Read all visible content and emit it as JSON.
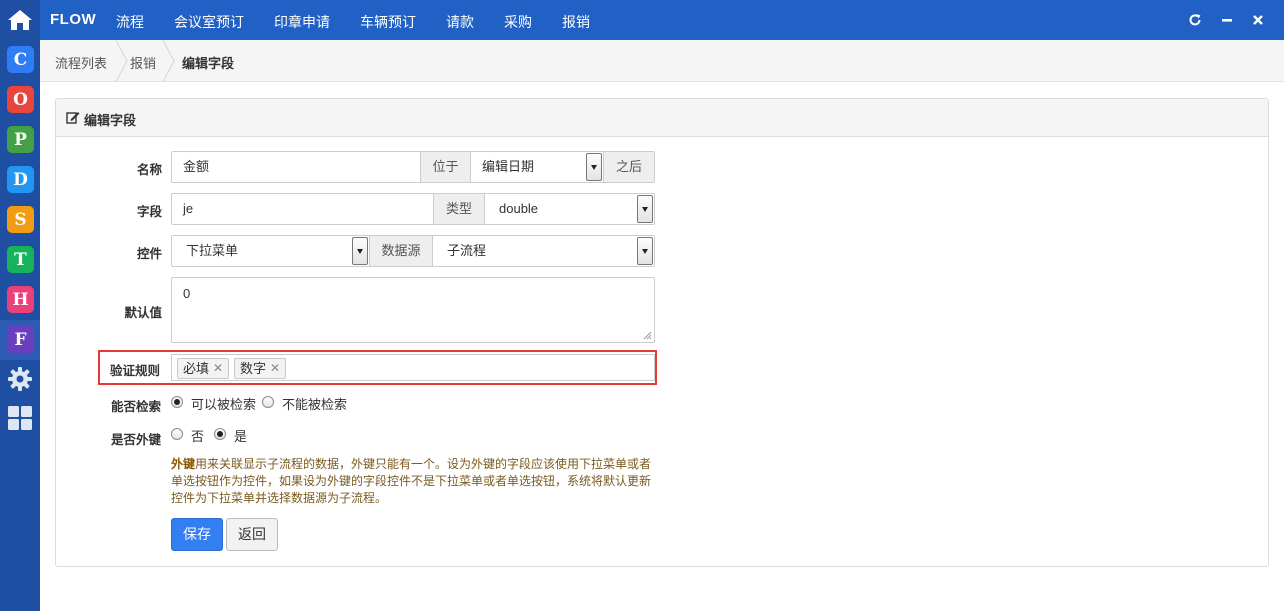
{
  "sidebar": {
    "apps": [
      {
        "letter": "C",
        "color": "#2f7df6"
      },
      {
        "letter": "O",
        "color": "#e8453c"
      },
      {
        "letter": "P",
        "color": "#43a047"
      },
      {
        "letter": "D",
        "color": "#2196f3"
      },
      {
        "letter": "S",
        "color": "#f39c12"
      },
      {
        "letter": "T",
        "color": "#17b35a"
      },
      {
        "letter": "H",
        "color": "#ec407a"
      },
      {
        "letter": "F",
        "color": "#6a3fbf"
      }
    ]
  },
  "topbar": {
    "brand": "FLOW",
    "nav": [
      "流程",
      "会议室预订",
      "印章申请",
      "车辆预订",
      "请款",
      "采购",
      "报销"
    ]
  },
  "breadcrumb": [
    "流程列表",
    "报销",
    "编辑字段"
  ],
  "panel": {
    "title": "编辑字段"
  },
  "form": {
    "name_label": "名称",
    "name_value": "金额",
    "position_label": "位于",
    "position_value": "编辑日期",
    "position_suffix": "之后",
    "field_label": "字段",
    "field_value": "je",
    "type_label": "类型",
    "type_value": "double",
    "control_label": "控件",
    "control_value": "下拉菜单",
    "datasource_label": "数据源",
    "datasource_value": "子流程",
    "default_label": "默认值",
    "default_value": "0",
    "rules_label": "验证规则",
    "rules": [
      "必填",
      "数字"
    ],
    "searchable_label": "能否检索",
    "searchable_options": [
      "可以被检索",
      "不能被检索"
    ],
    "searchable_selected": 0,
    "foreign_label": "是否外键",
    "foreign_options": [
      "否",
      "是"
    ],
    "foreign_selected": 1,
    "help_bold": "外键",
    "help_text": "用来关联显示子流程的数据，外键只能有一个。设为外键的字段应该使用下拉菜单或者单选按钮作为控件，如果设为外键的字段控件不是下拉菜单或者单选按钮，系统将默认更新控件为下拉菜单并选择数据源为子流程。",
    "save_label": "保存",
    "back_label": "返回"
  },
  "colors": {
    "topbar": "#2160c4",
    "sidebar": "#1f4fa3",
    "primary_button": "#337ef0",
    "highlight_border": "#e53935"
  }
}
